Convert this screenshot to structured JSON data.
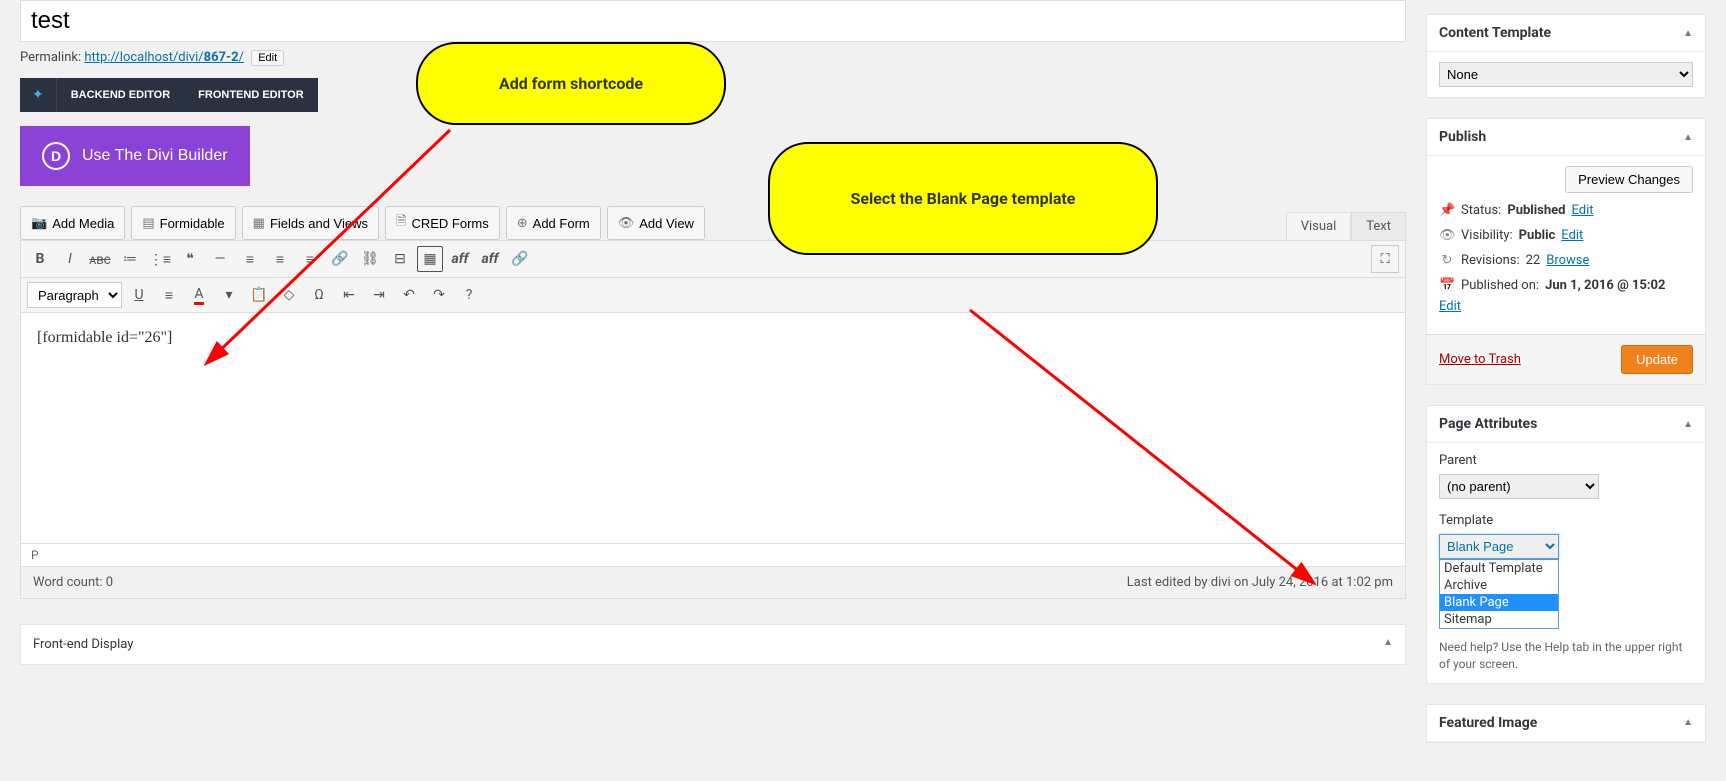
{
  "title_value": "test",
  "permalink_label": "Permalink:",
  "permalink_base": "http://localhost/divi/",
  "permalink_slug": "867-2",
  "edit_btn": "Edit",
  "backend_editor": "BACKEND EDITOR",
  "frontend_editor": "FRONTEND EDITOR",
  "divi_btn": "Use The Divi Builder",
  "media_buttons": {
    "add_media": "Add Media",
    "formidable": "Formidable",
    "fields_views": "Fields and Views",
    "cred_forms": "CRED Forms",
    "add_form": "Add Form",
    "add_view": "Add View"
  },
  "editor_tabs": {
    "visual": "Visual",
    "text": "Text"
  },
  "format_select": "Paragraph",
  "editor_content": "[formidable id=\"26\"]",
  "status_path": "P",
  "word_count_label": "Word count: 0",
  "last_edited": "Last edited by divi on July 24, 2016 at 1:02 pm",
  "frontend_display": "Front-end Display",
  "content_template": {
    "title": "Content Template",
    "value": "None"
  },
  "publish": {
    "title": "Publish",
    "preview": "Preview Changes",
    "status_label": "Status:",
    "status_value": "Published",
    "visibility_label": "Visibility:",
    "visibility_value": "Public",
    "revisions_label": "Revisions:",
    "revisions_value": "22",
    "browse": "Browse",
    "published_label": "Published on:",
    "published_value": "Jun 1, 2016 @ 15:02",
    "edit": "Edit",
    "trash": "Move to Trash",
    "update": "Update"
  },
  "page_attr": {
    "title": "Page Attributes",
    "parent_label": "Parent",
    "parent_value": "(no parent)",
    "template_label": "Template",
    "template_value": "Blank Page",
    "options": [
      "Default Template",
      "Archive",
      "Blank Page",
      "Sitemap"
    ],
    "help": "Need help? Use the Help tab in the upper right of your screen."
  },
  "featured_image": "Featured Image",
  "callout1": "Add form shortcode",
  "callout2": "Select the Blank Page template"
}
